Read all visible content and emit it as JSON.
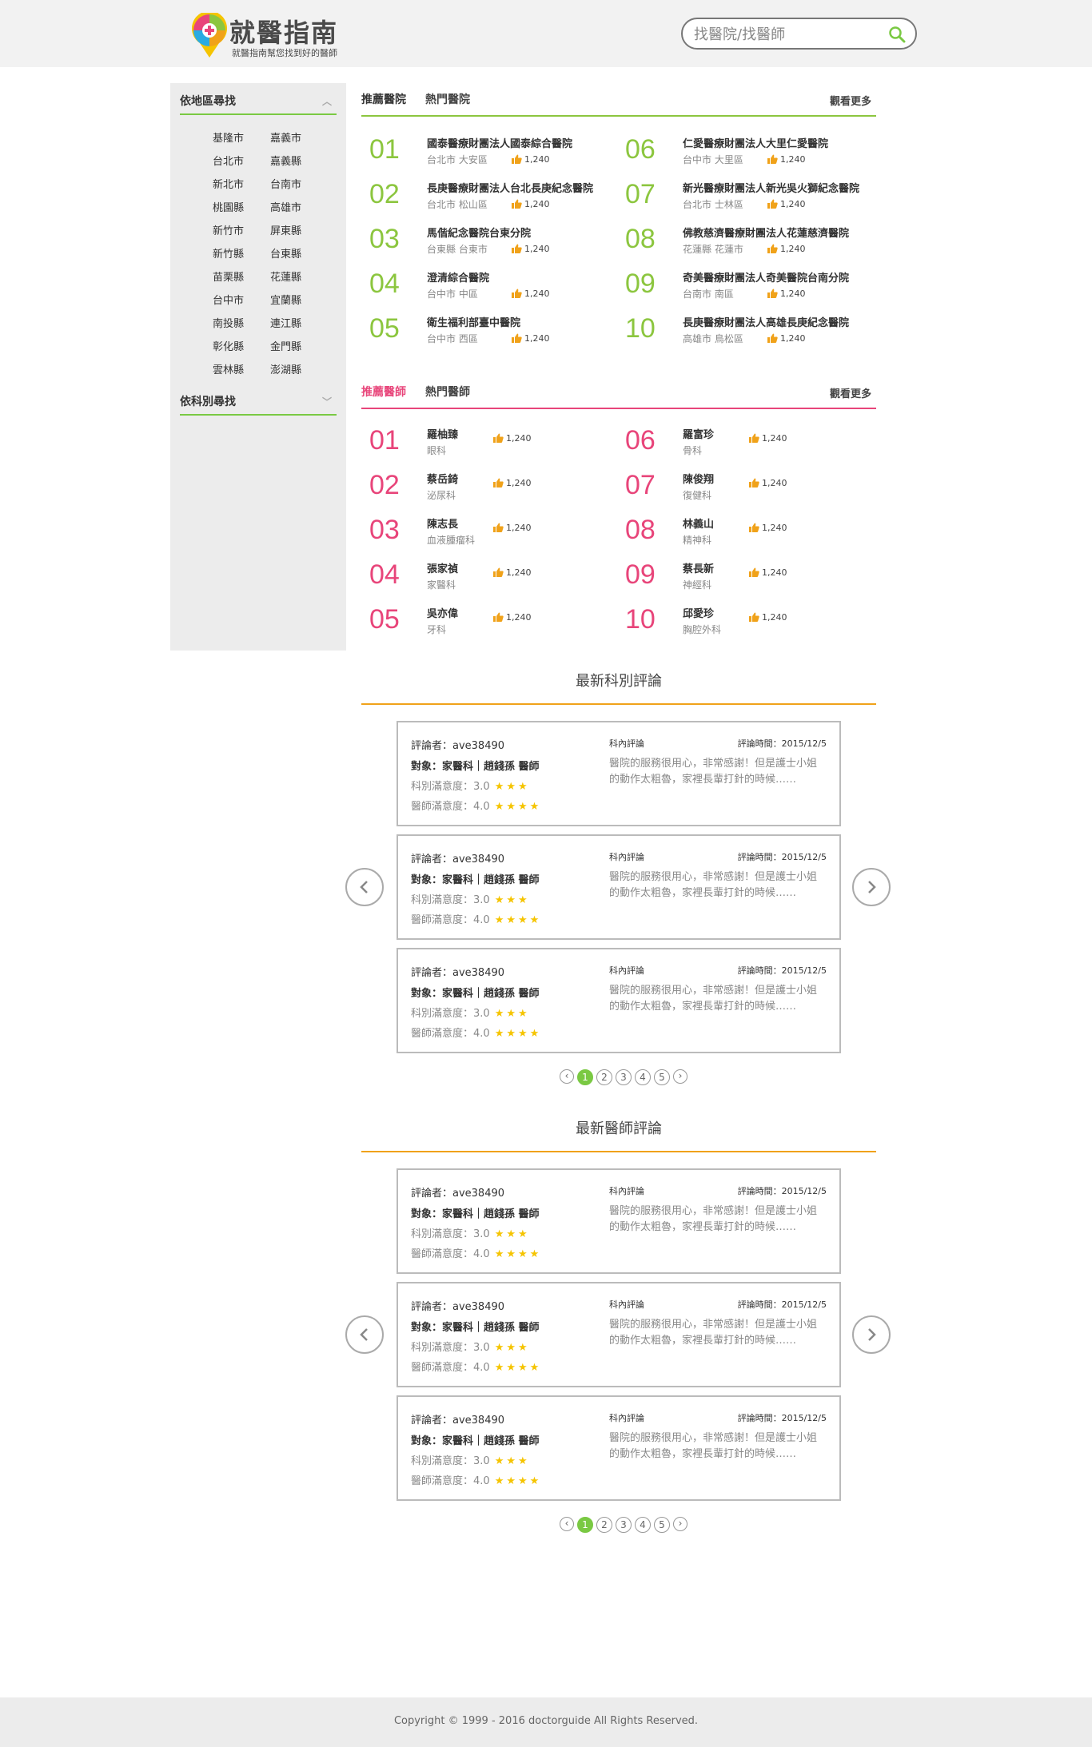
{
  "header": {
    "logo_title": "就醫指南",
    "logo_subtitle": "就醫指南幫您找到好的醫師",
    "search_placeholder": "找醫院/找醫師"
  },
  "sidebar": {
    "region_heading": "依地區尋找",
    "regions": [
      "基隆市",
      "嘉義市",
      "台北市",
      "嘉義縣",
      "新北市",
      "台南市",
      "桃園縣",
      "高雄市",
      "新竹市",
      "屏東縣",
      "新竹縣",
      "台東縣",
      "苗栗縣",
      "花蓮縣",
      "台中市",
      "宜蘭縣",
      "南投縣",
      "連江縣",
      "彰化縣",
      "金門縣",
      "雲林縣",
      "澎湖縣"
    ],
    "dept_heading": "依科別尋找"
  },
  "hospitals": {
    "tab_recommended": "推薦醫院",
    "tab_popular": "熱門醫院",
    "more": "觀看更多",
    "accent_color": "#8cc63f",
    "items": [
      {
        "num": "01",
        "name": "國泰醫療財團法人國泰綜合醫院",
        "area": "台北市 大安區",
        "likes": "1,240"
      },
      {
        "num": "02",
        "name": "長庚醫療財團法人台北長庚紀念醫院",
        "area": "台北市 松山區",
        "likes": "1,240"
      },
      {
        "num": "03",
        "name": "馬偕紀念醫院台東分院",
        "area": "台東縣 台東市",
        "likes": "1,240"
      },
      {
        "num": "04",
        "name": "澄清綜合醫院",
        "area": "台中市 中區",
        "likes": "1,240"
      },
      {
        "num": "05",
        "name": "衛生福利部臺中醫院",
        "area": "台中市 西區",
        "likes": "1,240"
      },
      {
        "num": "06",
        "name": "仁愛醫療財團法人大里仁愛醫院",
        "area": "台中市 大里區",
        "likes": "1,240"
      },
      {
        "num": "07",
        "name": "新光醫療財團法人新光吳火獅紀念醫院",
        "area": "台北市 士林區",
        "likes": "1,240"
      },
      {
        "num": "08",
        "name": "佛教慈濟醫療財團法人花蓮慈濟醫院",
        "area": "花蓮縣 花蓮市",
        "likes": "1,240"
      },
      {
        "num": "09",
        "name": "奇美醫療財團法人奇美醫院台南分院",
        "area": "台南市 南區",
        "likes": "1,240"
      },
      {
        "num": "10",
        "name": "長庚醫療財團法人高雄長庚紀念醫院",
        "area": "高雄市 鳥松區",
        "likes": "1,240"
      }
    ]
  },
  "doctors": {
    "tab_recommended": "推薦醫師",
    "tab_popular": "熱門醫師",
    "more": "觀看更多",
    "accent_color": "#e8457a",
    "items": [
      {
        "num": "01",
        "name": "羅柚臻",
        "dept": "眼科",
        "likes": "1,240"
      },
      {
        "num": "02",
        "name": "蔡岳錡",
        "dept": "泌尿科",
        "likes": "1,240"
      },
      {
        "num": "03",
        "name": "陳志長",
        "dept": "血液腫瘤科",
        "likes": "1,240"
      },
      {
        "num": "04",
        "name": "張家禎",
        "dept": "家醫科",
        "likes": "1,240"
      },
      {
        "num": "05",
        "name": "吳亦偉",
        "dept": "牙科",
        "likes": "1,240"
      },
      {
        "num": "06",
        "name": "羅富珍",
        "dept": "骨科",
        "likes": "1,240"
      },
      {
        "num": "07",
        "name": "陳俊翔",
        "dept": "復健科",
        "likes": "1,240"
      },
      {
        "num": "08",
        "name": "林義山",
        "dept": "精神科",
        "likes": "1,240"
      },
      {
        "num": "09",
        "name": "蔡長新",
        "dept": "神經科",
        "likes": "1,240"
      },
      {
        "num": "10",
        "name": "邱愛珍",
        "dept": "胸腔外科",
        "likes": "1,240"
      }
    ]
  },
  "review_sections": [
    {
      "title": "最新科別評論",
      "reviews": [
        {
          "reviewer": "評論者：ave38490",
          "target": "對象：家醫科｜趙錢孫 醫師",
          "dept_rating": "科別滿意度：3.0",
          "dept_stars": "★★★",
          "doc_rating": "醫師滿意度：4.0",
          "doc_stars": "★★★★",
          "type": "科內評論",
          "time": "評論時間：2015/12/5",
          "body": "醫院的服務很用心，非常感謝！但是護士小姐的動作太粗魯，家裡長輩打針的時候……"
        },
        {
          "reviewer": "評論者：ave38490",
          "target": "對象：家醫科｜趙錢孫 醫師",
          "dept_rating": "科別滿意度：3.0",
          "dept_stars": "★★★",
          "doc_rating": "醫師滿意度：4.0",
          "doc_stars": "★★★★",
          "type": "科內評論",
          "time": "評論時間：2015/12/5",
          "body": "醫院的服務很用心，非常感謝！但是護士小姐的動作太粗魯，家裡長輩打針的時候……"
        },
        {
          "reviewer": "評論者：ave38490",
          "target": "對象：家醫科｜趙錢孫 醫師",
          "dept_rating": "科別滿意度：3.0",
          "dept_stars": "★★★",
          "doc_rating": "醫師滿意度：4.0",
          "doc_stars": "★★★★",
          "type": "科內評論",
          "time": "評論時間：2015/12/5",
          "body": "醫院的服務很用心，非常感謝！但是護士小姐的動作太粗魯，家裡長輩打針的時候……"
        }
      ],
      "pages": [
        "1",
        "2",
        "3",
        "4",
        "5"
      ],
      "current_page": "1"
    },
    {
      "title": "最新醫師評論",
      "reviews": [
        {
          "reviewer": "評論者：ave38490",
          "target": "對象：家醫科｜趙錢孫 醫師",
          "dept_rating": "科別滿意度：3.0",
          "dept_stars": "★★★",
          "doc_rating": "醫師滿意度：4.0",
          "doc_stars": "★★★★",
          "type": "科內評論",
          "time": "評論時間：2015/12/5",
          "body": "醫院的服務很用心，非常感謝！但是護士小姐的動作太粗魯，家裡長輩打針的時候……"
        },
        {
          "reviewer": "評論者：ave38490",
          "target": "對象：家醫科｜趙錢孫 醫師",
          "dept_rating": "科別滿意度：3.0",
          "dept_stars": "★★★",
          "doc_rating": "醫師滿意度：4.0",
          "doc_stars": "★★★★",
          "type": "科內評論",
          "time": "評論時間：2015/12/5",
          "body": "醫院的服務很用心，非常感謝！但是護士小姐的動作太粗魯，家裡長輩打針的時候……"
        },
        {
          "reviewer": "評論者：ave38490",
          "target": "對象：家醫科｜趙錢孫 醫師",
          "dept_rating": "科別滿意度：3.0",
          "dept_stars": "★★★",
          "doc_rating": "醫師滿意度：4.0",
          "doc_stars": "★★★★",
          "type": "科內評論",
          "time": "評論時間：2015/12/5",
          "body": "醫院的服務很用心，非常感謝！但是護士小姐的動作太粗魯，家裡長輩打針的時候……"
        }
      ],
      "pages": [
        "1",
        "2",
        "3",
        "4",
        "5"
      ],
      "current_page": "1"
    }
  ],
  "footer": {
    "copyright": "Copyright © 1999 - 2016 doctorguide All Rights Reserved."
  },
  "colors": {
    "green": "#7ac943",
    "pink": "#e8457a",
    "orange": "#f0a21a",
    "like_icon": "#f0a21a",
    "star": "#f5c400"
  }
}
